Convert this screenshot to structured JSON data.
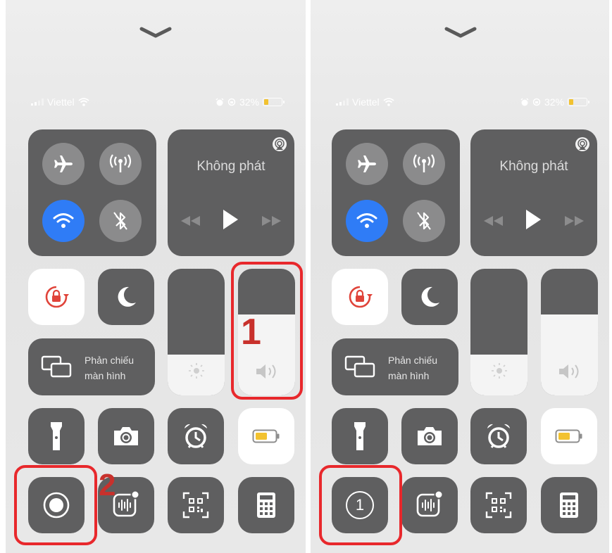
{
  "status_bar": {
    "carrier": "Viettel",
    "battery_percent": "32%",
    "battery_level": 0.32
  },
  "media": {
    "title": "Không phát"
  },
  "screen_mirroring": {
    "line1": "Phản chiếu",
    "line2": "màn hình"
  },
  "left_panel": {
    "brightness_level": 0.32,
    "volume_level": 0.64,
    "record_state": "idle"
  },
  "right_panel": {
    "brightness_level": 0.32,
    "volume_level": 0.64,
    "record_countdown": "1"
  },
  "annotations": {
    "step_1": "1",
    "step_2": "2",
    "highlight_color": "#e8282c"
  },
  "icons": [
    "chevron-down-icon",
    "airplane-mode-icon",
    "cellular-data-icon",
    "wifi-icon",
    "bluetooth-icon",
    "airplay-icon",
    "rewind-icon",
    "play-icon",
    "fast-forward-icon",
    "rotation-lock-icon",
    "moon-icon",
    "screen-mirroring-icon",
    "brightness-icon",
    "volume-icon",
    "flashlight-icon",
    "camera-icon",
    "alarm-clock-icon",
    "low-power-mode-icon",
    "screen-record-icon",
    "voice-memos-icon",
    "qr-code-scanner-icon",
    "calculator-icon",
    "alarm-status-icon",
    "orientation-lock-status-icon"
  ],
  "colors": {
    "tile": "#5f5f60",
    "wifi_active": "#2f7cf6",
    "rotation_lock": "#e0443a",
    "battery_fill": "#f2c230"
  }
}
